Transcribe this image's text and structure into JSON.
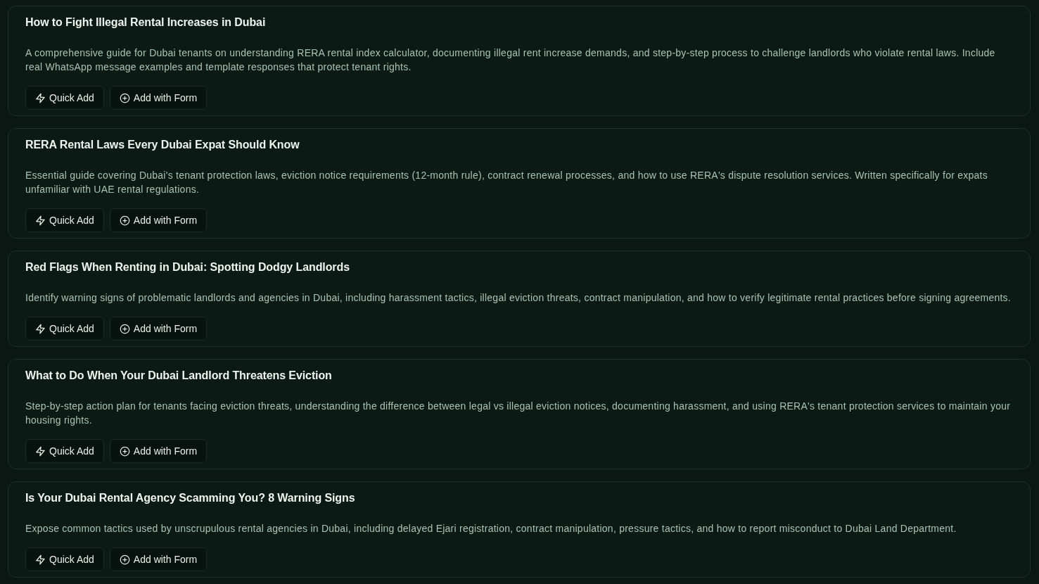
{
  "articles": [
    {
      "title": "How to Fight Illegal Rental Increases in Dubai",
      "description": "A comprehensive guide for Dubai tenants on understanding RERA rental index calculator, documenting illegal rent increase demands, and step-by-step process to challenge landlords who violate rental laws. Include real WhatsApp message examples and template responses that protect tenant rights.",
      "actions": [
        {
          "kind": "quick",
          "label": "Quick Add"
        },
        {
          "kind": "form",
          "label": "Add with Form"
        }
      ]
    },
    {
      "title": "RERA Rental Laws Every Dubai Expat Should Know",
      "description": "Essential guide covering Dubai's tenant protection laws, eviction notice requirements (12-month rule), contract renewal processes, and how to use RERA's dispute resolution services. Written specifically for expats unfamiliar with UAE rental regulations.",
      "actions": [
        {
          "kind": "quick",
          "label": "Quick Add"
        },
        {
          "kind": "form",
          "label": "Add with Form"
        }
      ]
    },
    {
      "title": "Red Flags When Renting in Dubai: Spotting Dodgy Landlords",
      "description": "Identify warning signs of problematic landlords and agencies in Dubai, including harassment tactics, illegal eviction threats, contract manipulation, and how to verify legitimate rental practices before signing agreements.",
      "actions": [
        {
          "kind": "quick",
          "label": "Quick Add"
        },
        {
          "kind": "form",
          "label": "Add with Form"
        }
      ]
    },
    {
      "title": "What to Do When Your Dubai Landlord Threatens Eviction",
      "description": "Step-by-step action plan for tenants facing eviction threats, understanding the difference between legal vs illegal eviction notices, documenting harassment, and using RERA's tenant protection services to maintain your housing rights.",
      "actions": [
        {
          "kind": "quick",
          "label": "Quick Add"
        },
        {
          "kind": "form",
          "label": "Add with Form"
        }
      ]
    },
    {
      "title": "Is Your Dubai Rental Agency Scamming You? 8 Warning Signs",
      "description": "Expose common tactics used by unscrupulous rental agencies in Dubai, including delayed Ejari registration, contract manipulation, pressure tactics, and how to report misconduct to Dubai Land Department.",
      "actions": [
        {
          "kind": "quick",
          "label": "Quick Add"
        },
        {
          "kind": "form",
          "label": "Add with Form"
        }
      ]
    }
  ]
}
